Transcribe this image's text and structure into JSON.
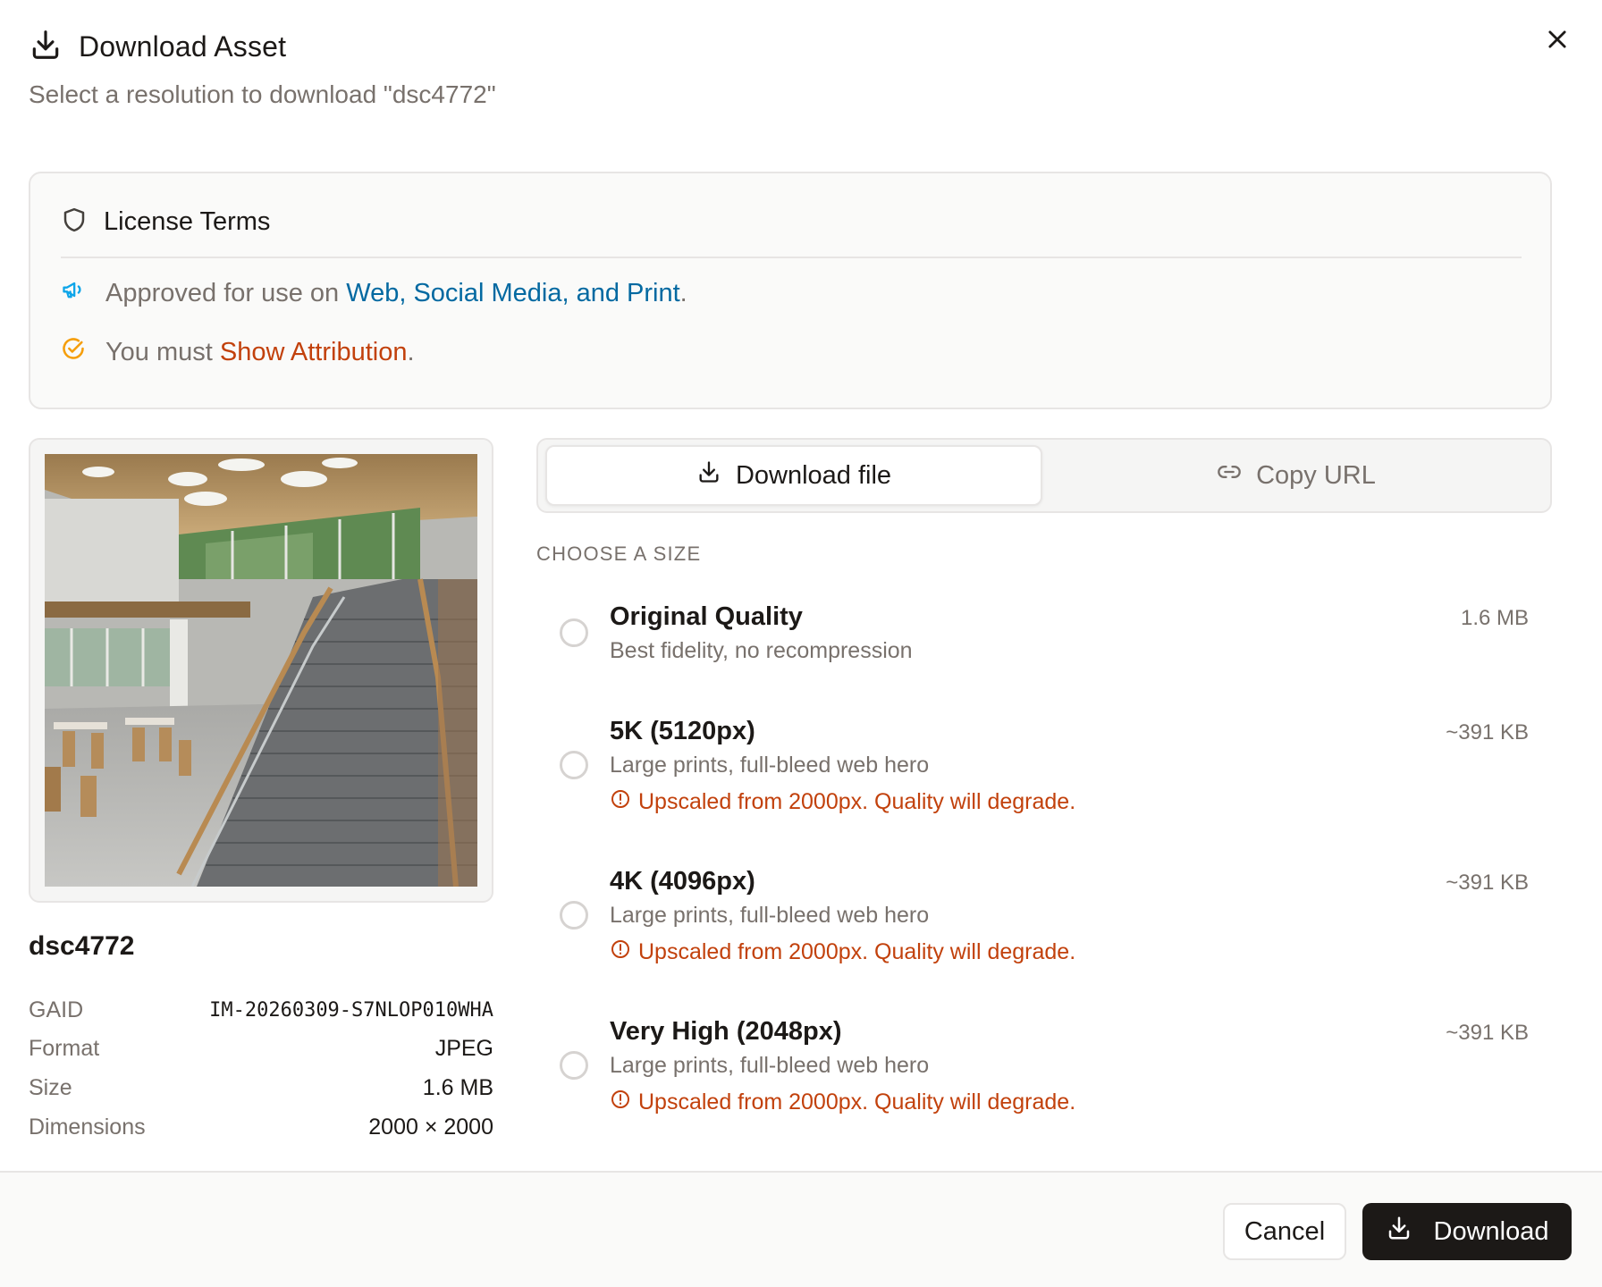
{
  "header": {
    "title": "Download Asset",
    "subtitle": "Select a resolution to download \"dsc4772\""
  },
  "license": {
    "title": "License Terms",
    "usage_prefix": "Approved for use on ",
    "usage_highlight": "Web, Social Media, and Print",
    "usage_suffix": ".",
    "attribution_prefix": "You must ",
    "attribution_highlight": "Show Attribution",
    "attribution_suffix": ".",
    "colors": {
      "usage": "#0369a1",
      "attribution": "#c2410c",
      "attribution_icon": "#f59e0b",
      "usage_icon": "#0ea5e9"
    }
  },
  "asset": {
    "name": "dsc4772",
    "meta": [
      {
        "key": "GAID",
        "value": "IM-20260309-S7NLOP010WHA"
      },
      {
        "key": "Format",
        "value": "JPEG"
      },
      {
        "key": "Size",
        "value": "1.6 MB"
      },
      {
        "key": "Dimensions",
        "value": "2000 × 2000"
      }
    ]
  },
  "tabs": [
    {
      "label": "Download file",
      "icon": "download-icon",
      "active": true
    },
    {
      "label": "Copy URL",
      "icon": "link-icon",
      "active": false
    }
  ],
  "choose_label": "CHOOSE A SIZE",
  "options": [
    {
      "name": "Original Quality",
      "size": "1.6 MB",
      "desc": "Best fidelity, no recompression",
      "warning": ""
    },
    {
      "name": "5K (5120px)",
      "size": "~391 KB",
      "desc": "Large prints, full-bleed web hero",
      "warning": "Upscaled from 2000px. Quality will degrade."
    },
    {
      "name": "4K (4096px)",
      "size": "~391 KB",
      "desc": "Large prints, full-bleed web hero",
      "warning": "Upscaled from 2000px. Quality will degrade."
    },
    {
      "name": "Very High (2048px)",
      "size": "~391 KB",
      "desc": "Large prints, full-bleed web hero",
      "warning": "Upscaled from 2000px. Quality will degrade."
    }
  ],
  "footer": {
    "cancel_label": "Cancel",
    "download_label": "Download"
  },
  "colors": {
    "primary": "#1c1917",
    "warning": "#c2410c",
    "muted": "#78716c",
    "border": "#e7e5e4"
  }
}
